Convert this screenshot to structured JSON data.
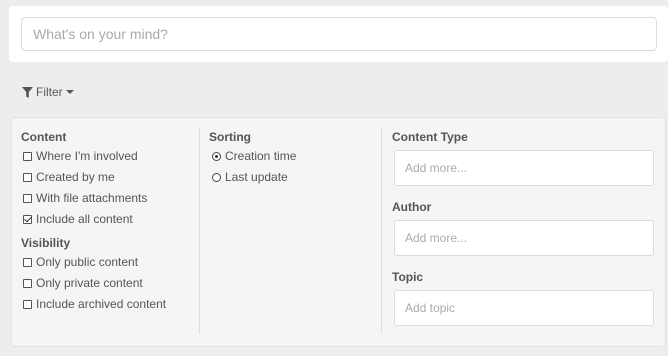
{
  "post": {
    "placeholder": "What's on your mind?"
  },
  "filter": {
    "label": "Filter"
  },
  "content": {
    "title": "Content",
    "options": [
      {
        "label": "Where I'm involved",
        "checked": false
      },
      {
        "label": "Created by me",
        "checked": false
      },
      {
        "label": "With file attachments",
        "checked": false
      },
      {
        "label": "Include all content",
        "checked": true
      }
    ]
  },
  "visibility": {
    "title": "Visibility",
    "options": [
      {
        "label": "Only public content",
        "checked": false
      },
      {
        "label": "Only private content",
        "checked": false
      },
      {
        "label": "Include archived content",
        "checked": false
      }
    ]
  },
  "sorting": {
    "title": "Sorting",
    "options": [
      {
        "label": "Creation time",
        "selected": true
      },
      {
        "label": "Last update",
        "selected": false
      }
    ]
  },
  "content_type": {
    "title": "Content Type",
    "placeholder": "Add more..."
  },
  "author": {
    "title": "Author",
    "placeholder": "Add more..."
  },
  "topic": {
    "title": "Topic",
    "placeholder": "Add topic"
  }
}
